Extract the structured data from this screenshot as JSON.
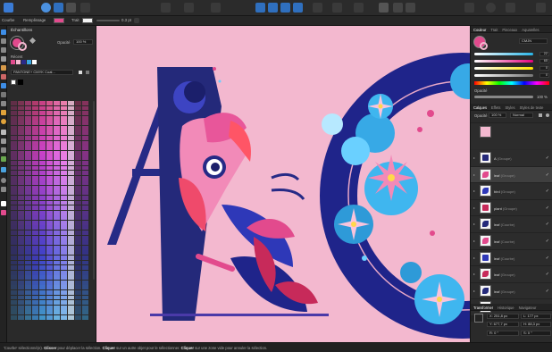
{
  "context_bar": {
    "stroke_label": "Courbe",
    "fill_label": "Remplissage",
    "line_label": "Trait",
    "line_width": "0.3 pt"
  },
  "left_panel": {
    "tab": "Échantillons",
    "opacity_label": "Opacité",
    "opacity_value": "100 %",
    "recent_label": "Récent",
    "palette_name": "PANTONE+ CMYK Coat..."
  },
  "right_panel": {
    "color_tabs": [
      "Couleur",
      "Trait",
      "Pinceaux",
      "Aquarelles"
    ],
    "color_mode": "CMJN",
    "cmyk_values": [
      "22",
      "65",
      "0",
      "0"
    ],
    "color_channels": [
      {
        "name": "cyan",
        "color": "#29b5e8"
      },
      {
        "name": "magenta",
        "color": "#e6007e"
      },
      {
        "name": "yellow",
        "color": "#ffe600"
      },
      {
        "name": "black",
        "color": "#777777"
      }
    ],
    "opacity_label": "Opacité",
    "opacity_value": "100 %",
    "layer_tabs": [
      "Calques",
      "Effets",
      "Styles",
      "Styles de texte"
    ],
    "layer_opacity_label": "Opacité",
    "layer_opacity_value": "100 %",
    "blend_mode": "Normal",
    "layers": [
      {
        "name": "A",
        "meta": "(Groupe)",
        "selected": false
      },
      {
        "name": "leaf",
        "meta": "(Groupe)",
        "selected": true
      },
      {
        "name": "bird",
        "meta": "(Groupe)",
        "selected": false
      },
      {
        "name": "plant",
        "meta": "(Groupe)",
        "selected": false
      },
      {
        "name": "leaf",
        "meta": "(Courbe)",
        "selected": false
      },
      {
        "name": "leaf",
        "meta": "(Courbe)",
        "selected": false
      },
      {
        "name": "leaf",
        "meta": "(Courbe)",
        "selected": false
      },
      {
        "name": "leaf",
        "meta": "(Groupe)",
        "selected": false
      },
      {
        "name": "leaf",
        "meta": "(Groupe)",
        "selected": false
      },
      {
        "name": "(Courbe)",
        "meta": "",
        "selected": false
      }
    ],
    "transform_tabs": [
      "Transformer",
      "Historique",
      "Navigateur"
    ],
    "transform": {
      "x": "251,8 px",
      "y": "677,7 px",
      "w": "177 px",
      "h": "88,3 px",
      "r": "0 °",
      "s": "0 °"
    }
  },
  "status_bar": {
    "prefix": "'Courbe' sélectionné(e). ",
    "bold1": "Glisser",
    "text1": " pour déplacer la sélection. ",
    "bold2": "Cliquer",
    "text2": " sur un autre objet pour le sélectionner. ",
    "bold3": "Cliquer",
    "text3": " sur une zone vide pour annuler la sélection."
  }
}
